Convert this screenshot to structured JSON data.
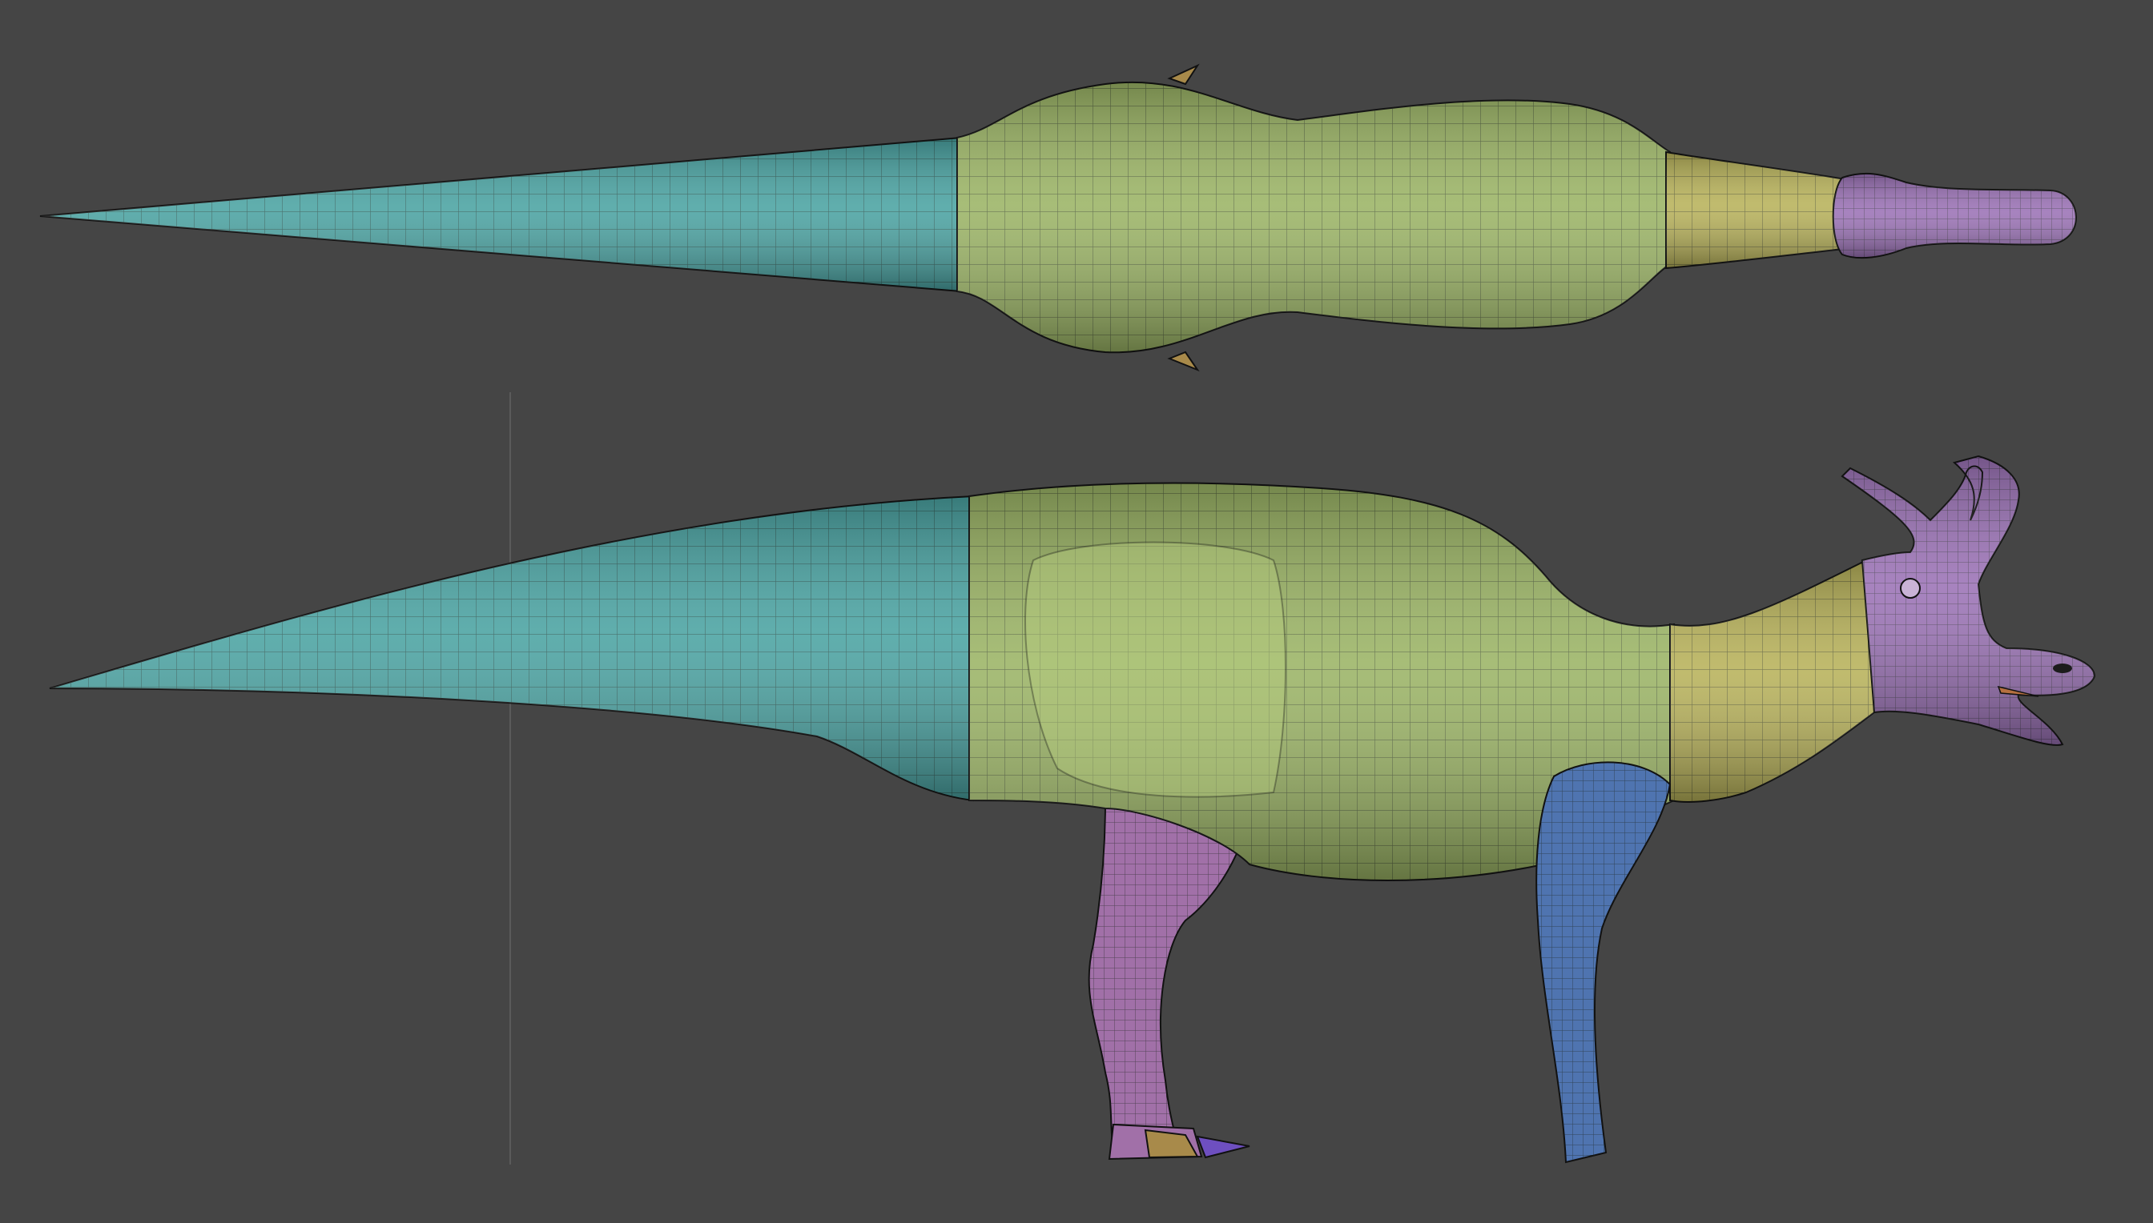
{
  "scene": {
    "background": "#454545",
    "views": [
      {
        "name": "top-view"
      },
      {
        "name": "side-view"
      }
    ],
    "polygroup_colors": {
      "tail": "#4aa3a2",
      "torso": "#9bb465",
      "neck": "#b8b25a",
      "head": "#9b72b6",
      "hind_leg": "#a170a8",
      "front_leg": "#4f74b0",
      "foot": "#a88a4a",
      "claw": "#6e4fc0",
      "wire": "#1e2620"
    }
  }
}
